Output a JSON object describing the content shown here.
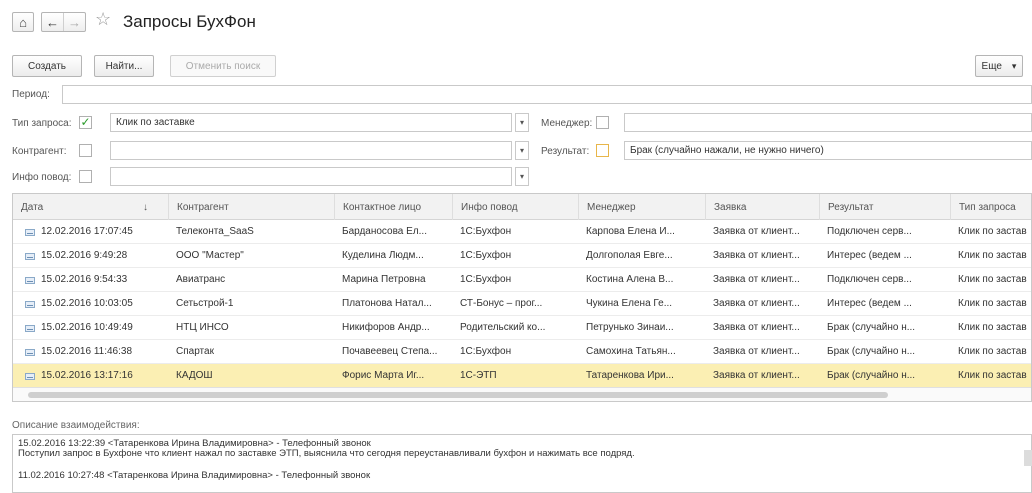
{
  "title": "Запросы БухФон",
  "nav": {
    "home_icon": "home-icon",
    "back": "←",
    "forward": "→",
    "star": "☆"
  },
  "toolbar": {
    "create": "Создать",
    "find": "Найти...",
    "cancel_search": "Отменить поиск",
    "more": "Еще",
    "more_chevron": "▾"
  },
  "filters": {
    "period_label": "Период:",
    "request_type_label": "Тип запроса:",
    "request_type_value": "Клик по заставке",
    "manager_label": "Менеджер:",
    "counterparty_label": "Контрагент:",
    "result_label": "Результат:",
    "result_value": "Брак (случайно нажали, не нужно ничего)",
    "info_reason_label": "Инфо повод:",
    "checkmark": "✓",
    "dropdown_arrow": "▾"
  },
  "table": {
    "sort_arrow": "↓",
    "columns": [
      "Дата",
      "Контрагент",
      "Контактное лицо",
      "Инфо повод",
      "Менеджер",
      "Заявка",
      "Результат",
      "Тип запроса"
    ],
    "rows": [
      [
        "12.02.2016 17:07:45",
        "Телеконта_SaaS",
        "Барданосова Ел...",
        "1С:Бухфон",
        "Карпова Елена И...",
        "Заявка от клиент...",
        "Подключен серв...",
        "Клик по застав"
      ],
      [
        "15.02.2016 9:49:28",
        "ООО \"Мастер\"",
        "Куделина Людм...",
        "1С:Бухфон",
        "Долгополая Евге...",
        "Заявка от клиент...",
        "Интерес (ведем ...",
        "Клик по застав"
      ],
      [
        "15.02.2016 9:54:33",
        "Авиатранс",
        "Марина Петровна",
        "1С:Бухфон",
        "Костина Алена В...",
        "Заявка от клиент...",
        "Подключен серв...",
        "Клик по застав"
      ],
      [
        "15.02.2016 10:03:05",
        "Сетьстрой-1",
        "Платонова Натал...",
        "СТ-Бонус – прог...",
        "Чукина Елена Ге...",
        "Заявка от клиент...",
        "Интерес (ведем ...",
        "Клик по застав"
      ],
      [
        "15.02.2016 10:49:49",
        "НТЦ ИНСО",
        "Никифоров Андр...",
        "Родительский ко...",
        "Петрунько Зинаи...",
        "Заявка от клиент...",
        "Брак (случайно н...",
        "Клик по застав"
      ],
      [
        "15.02.2016 11:46:38",
        "Спартак",
        "Почавеевец Степа...",
        "1С:Бухфон",
        "Самохина Татьян...",
        "Заявка от клиент...",
        "Брак (случайно н...",
        "Клик по застав"
      ],
      [
        "15.02.2016 13:17:16",
        "КАДОШ",
        "Форис Марта Иг...",
        "1С-ЭТП",
        "Татаренкова Ири...",
        "Заявка от клиент...",
        "Брак (случайно н...",
        "Клик по застав"
      ]
    ],
    "selected_index": 6
  },
  "description": {
    "label": "Описание взаимодействия:",
    "lines": [
      "15.02.2016 13:22:39  <Татаренкова Ирина Владимировна>  -  Телефонный звонок",
      "Поступил запрос в Бухфоне что клиент нажал по заставке ЭТП, выяснила что сегодня переустанавливали бухфон и нажимать все подряд.",
      "11.02.2016 10:27:48  <Татаренкова Ирина Владимировна>  -  Телефонный звонок"
    ]
  }
}
